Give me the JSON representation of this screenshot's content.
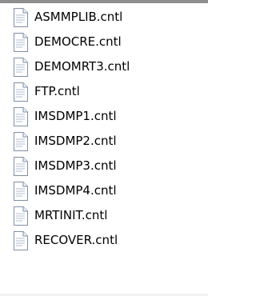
{
  "files": [
    {
      "name": "ASMMPLIB.cntl",
      "icon": "text-document-icon"
    },
    {
      "name": "DEMOCRE.cntl",
      "icon": "text-document-icon"
    },
    {
      "name": "DEMOMRT3.cntl",
      "icon": "text-document-icon"
    },
    {
      "name": "FTP.cntl",
      "icon": "text-document-icon"
    },
    {
      "name": "IMSDMP1.cntl",
      "icon": "text-document-icon"
    },
    {
      "name": "IMSDMP2.cntl",
      "icon": "text-document-icon"
    },
    {
      "name": "IMSDMP3.cntl",
      "icon": "text-document-icon"
    },
    {
      "name": "IMSDMP4.cntl",
      "icon": "text-document-icon"
    },
    {
      "name": "MRTINIT.cntl",
      "icon": "text-document-icon"
    },
    {
      "name": "RECOVER.cntl",
      "icon": "text-document-icon"
    }
  ],
  "colors": {
    "text": "#000000",
    "background": "#ffffff",
    "icon_outline": "#7f8fa6",
    "icon_lines": "#b0bccd",
    "frame_border": "#8e8e8e"
  }
}
